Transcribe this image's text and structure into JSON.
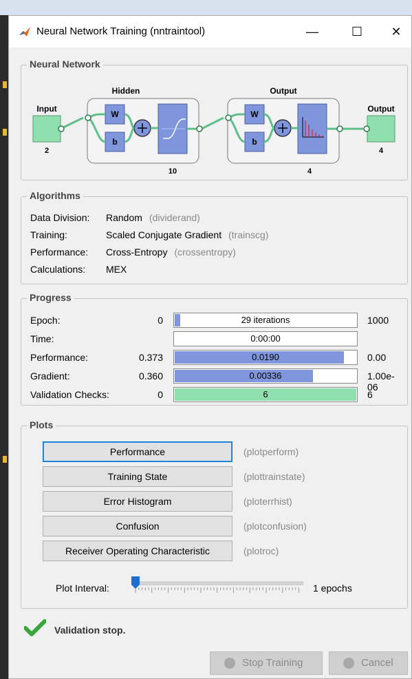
{
  "window": {
    "title": "Neural Network Training (nntraintool)",
    "controls": {
      "minimize": "—",
      "maximize": "☐",
      "close": "✕"
    }
  },
  "network": {
    "panel_title": "Neural Network",
    "input_label": "Input",
    "input_size": "2",
    "hidden_label": "Hidden",
    "hidden_size": "10",
    "output_layer_label": "Output",
    "output_layer_size": "4",
    "output_label": "Output",
    "output_size": "4",
    "w_label": "W",
    "b_label": "b"
  },
  "algorithms": {
    "panel_title": "Algorithms",
    "rows": [
      {
        "key": "Data Division:",
        "value": "Random",
        "fn": "(dividerand)"
      },
      {
        "key": "Training:",
        "value": "Scaled Conjugate Gradient",
        "fn": "(trainscg)"
      },
      {
        "key": "Performance:",
        "value": "Cross-Entropy",
        "fn": "(crossentropy)"
      },
      {
        "key": "Calculations:",
        "value": "MEX",
        "fn": ""
      }
    ]
  },
  "progress": {
    "panel_title": "Progress",
    "rows": [
      {
        "key": "Epoch:",
        "start": "0",
        "bar": "29 iterations",
        "end": "1000",
        "fill": 0.029,
        "color": "#7f96dc"
      },
      {
        "key": "Time:",
        "start": "",
        "bar": "0:00:00",
        "end": "",
        "fill": 0,
        "color": "#7f96dc"
      },
      {
        "key": "Performance:",
        "start": "0.373",
        "bar": "0.0190",
        "end": "0.00",
        "fill": 0.93,
        "color": "#7f96dc"
      },
      {
        "key": "Gradient:",
        "start": "0.360",
        "bar": "0.00336",
        "end": "1.00e-06",
        "fill": 0.76,
        "color": "#7f96dc"
      },
      {
        "key": "Validation Checks:",
        "start": "0",
        "bar": "6",
        "end": "6",
        "fill": 1.0,
        "color": "#8fe0ae"
      }
    ]
  },
  "plots": {
    "panel_title": "Plots",
    "buttons": [
      {
        "label": "Performance",
        "fn": "(plotperform)"
      },
      {
        "label": "Training State",
        "fn": "(plottrainstate)"
      },
      {
        "label": "Error Histogram",
        "fn": "(ploterrhist)"
      },
      {
        "label": "Confusion",
        "fn": "(plotconfusion)"
      },
      {
        "label": "Receiver Operating Characteristic",
        "fn": "(plotroc)"
      }
    ],
    "interval_label": "Plot Interval:",
    "interval_value": "1 epochs",
    "interval_position": 0
  },
  "status": {
    "text": "Validation stop."
  },
  "footer": {
    "stop_label": "Stop Training",
    "cancel_label": "Cancel"
  },
  "colors": {
    "layer_box": "#7f96dc",
    "io_box": "#8fe0ae",
    "progress_fill": "#7f96dc",
    "validation_fill": "#8fe0ae",
    "check_green": "#3aa53a",
    "matlab_orange": "#e0651b"
  }
}
